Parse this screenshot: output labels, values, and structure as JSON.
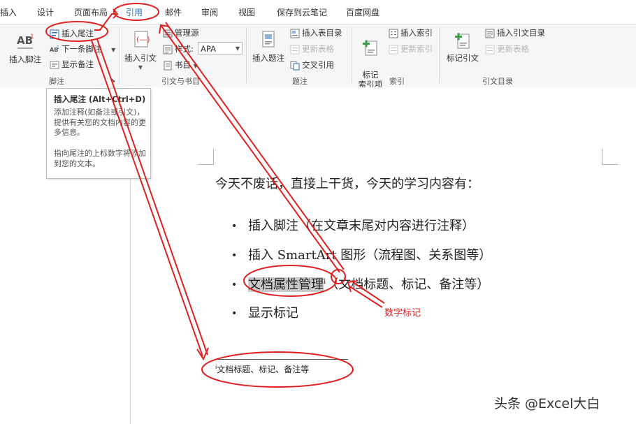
{
  "tabs": [
    "插入",
    "设计",
    "页面布局",
    "引用",
    "邮件",
    "审阅",
    "视图",
    "保存到云笔记",
    "百度网盘"
  ],
  "footnote_group": {
    "insert_footnote": "插入脚注",
    "insert_endnote": "插入尾注",
    "next_footnote": "下一条脚注",
    "show_notes": "显示备注",
    "label": "脚注"
  },
  "citation_group": {
    "insert_citation": "插入引文",
    "manage_sources": "管理源",
    "style_label": "样式:",
    "style_value": "APA",
    "bibliography": "书目",
    "label": "引文与书目"
  },
  "caption_group": {
    "insert_caption": "插入题注",
    "insert_table_of_figures": "插入表目录",
    "update_table": "更新表格",
    "cross_reference": "交叉引用",
    "label": "题注"
  },
  "index_group": {
    "mark_entry": "标记\n索引项",
    "insert_index": "插入索引",
    "update_index": "更新索引",
    "label": "索引"
  },
  "toa_group": {
    "mark_citation": "标记引文",
    "insert_toa": "插入引文目录",
    "update_table": "更新表格",
    "label": "引文目录"
  },
  "tooltip": {
    "title": "插入尾注 (Alt+Ctrl+D)",
    "desc1": "添加注释(如备注或引文)，提供有关您的文档内容的更多信息。",
    "desc2": "指向尾注的上标数字将添加到您的文本。"
  },
  "document": {
    "intro": "今天不废话，直接上干货，今天的学习内容有：",
    "bullets": [
      "插入脚注（在文章末尾对内容进行注释）",
      "插入 SmartArt 图形（流程图、关系图等）",
      "（文档标题、标记、备注等）",
      "显示标记"
    ],
    "highlighted": "文档属性管理",
    "marker": "i",
    "footnote_text": "文档标题、标记、备注等"
  },
  "annotation_label": "数字标记",
  "watermark": "头条 @Excel大白",
  "colors": {
    "accent": "#2a6ebb",
    "annotation": "#e02020"
  }
}
